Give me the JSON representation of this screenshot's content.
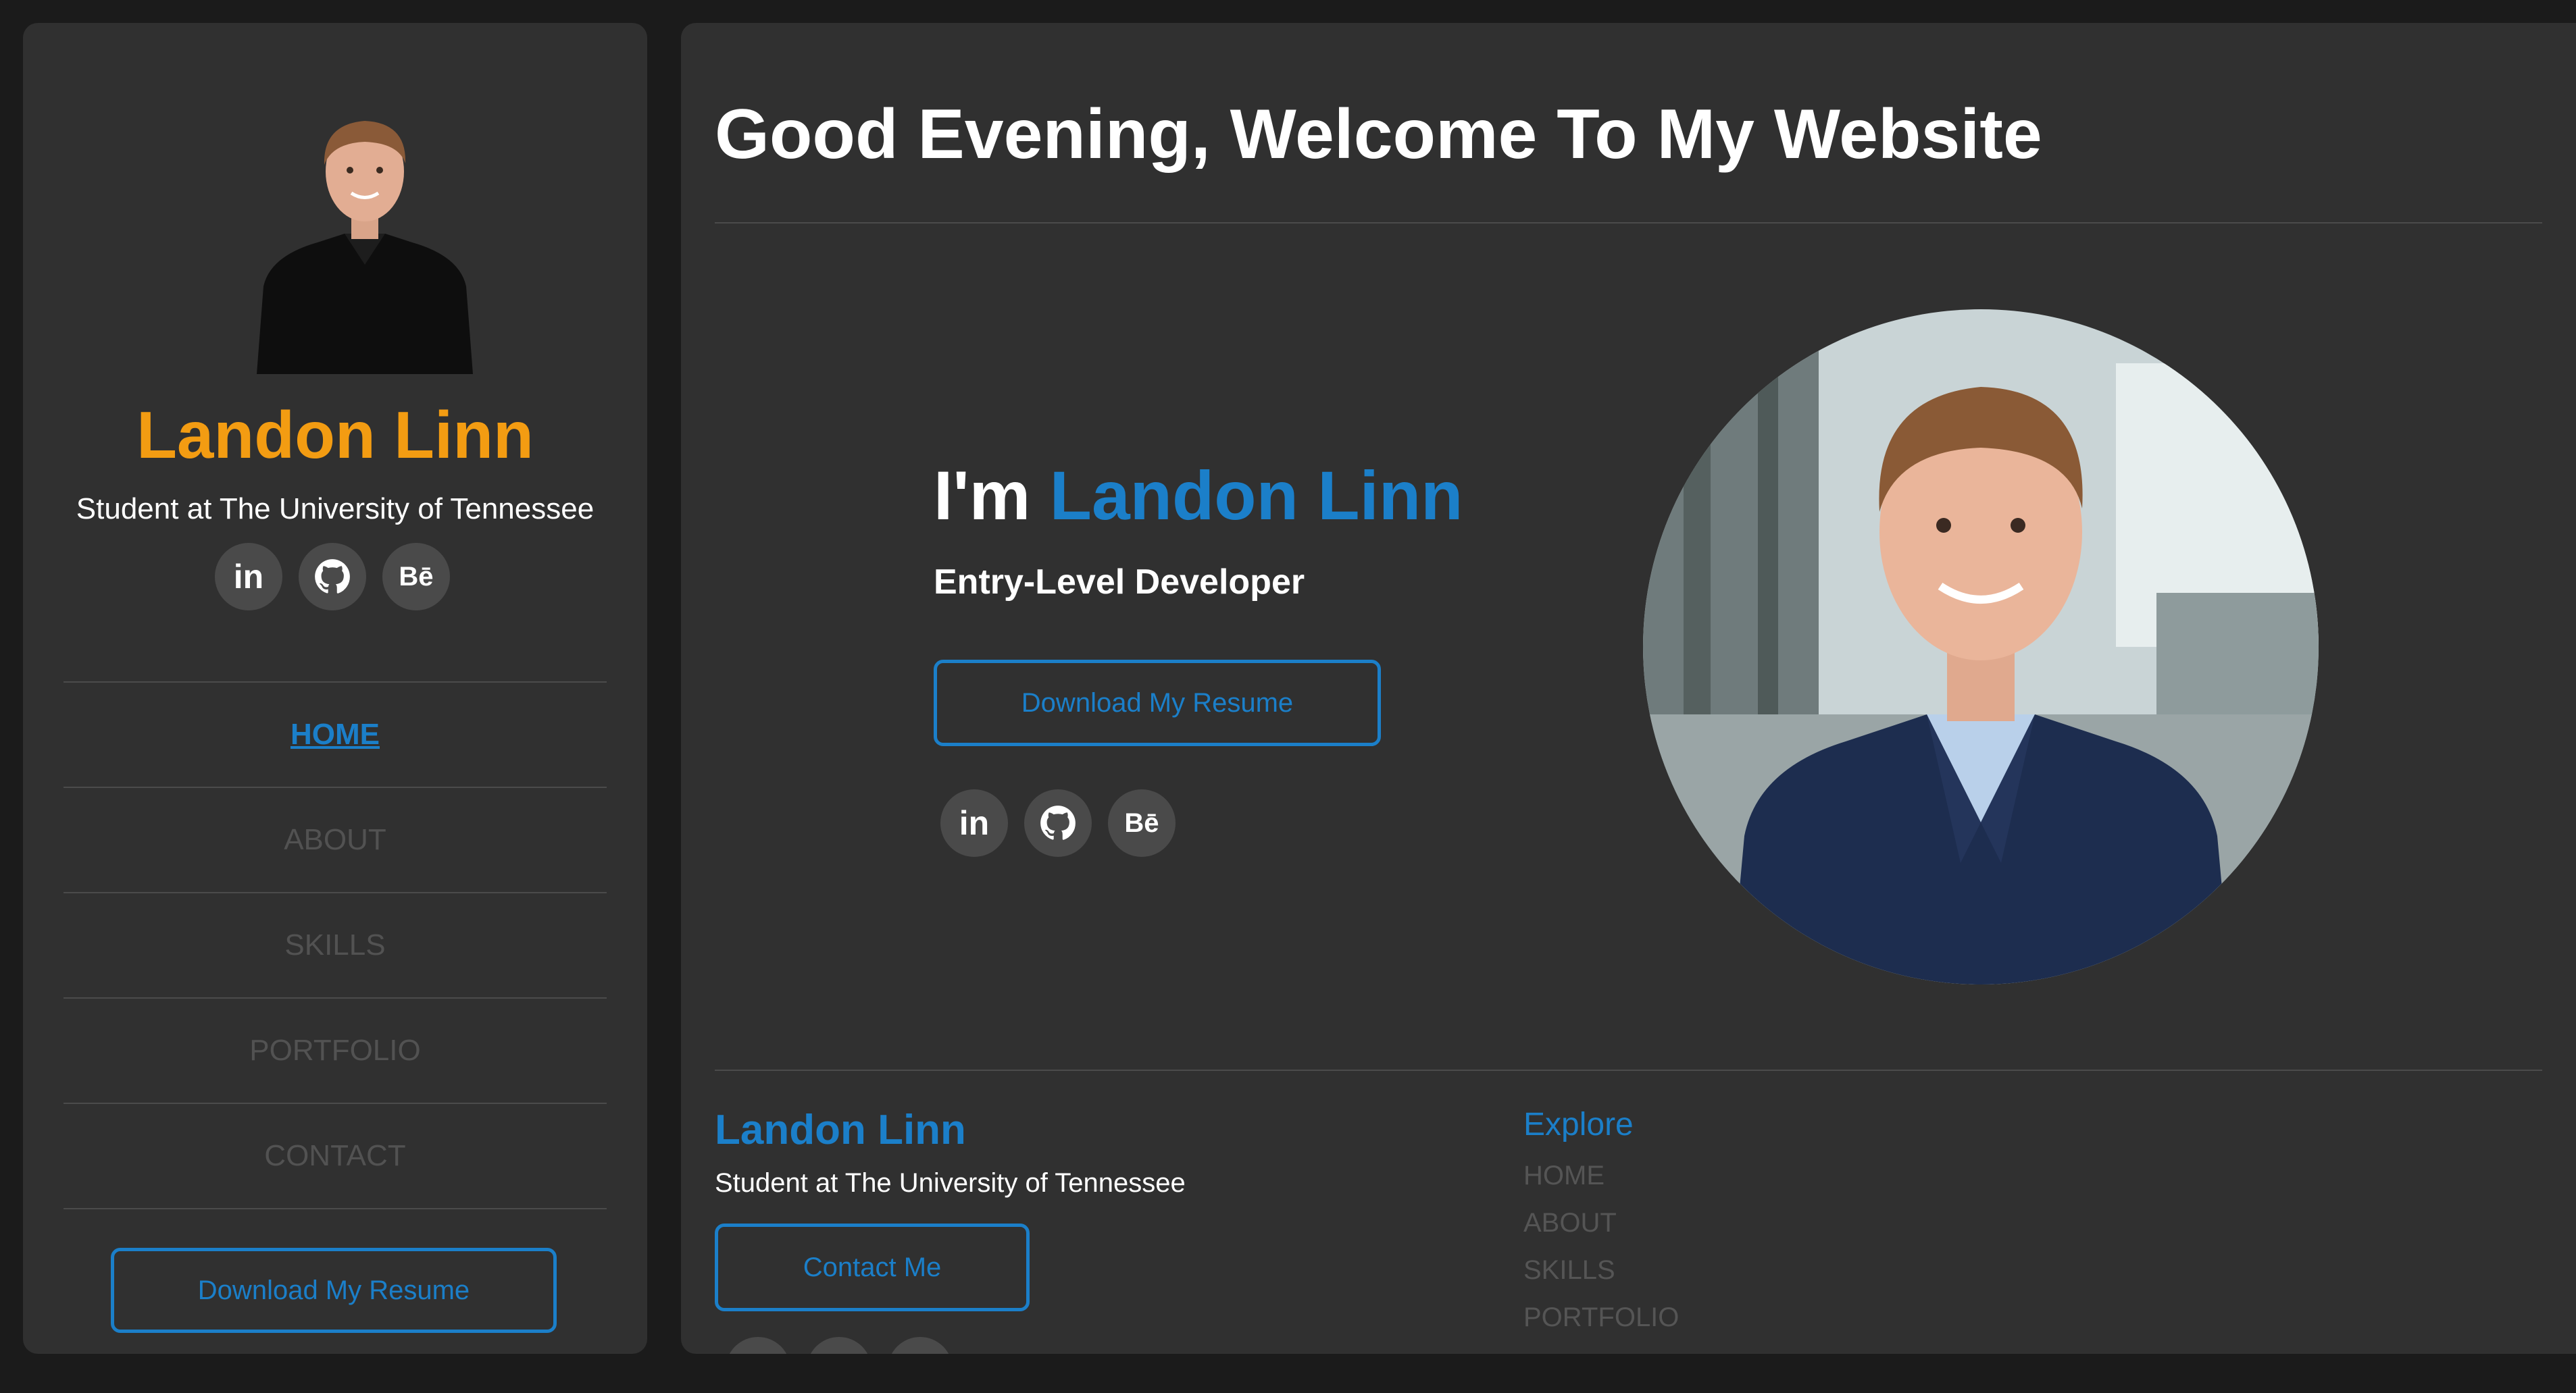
{
  "sidebar": {
    "name": "Landon Linn",
    "subtitle": "Student at The University of Tennessee",
    "socials": [
      {
        "icon": "linkedin-icon",
        "glyph": "in"
      },
      {
        "icon": "github-icon",
        "glyph": ""
      },
      {
        "icon": "behance-icon",
        "glyph": "Bē"
      }
    ],
    "nav": [
      {
        "label": "HOME",
        "active": true
      },
      {
        "label": "ABOUT",
        "active": false
      },
      {
        "label": "SKILLS",
        "active": false
      },
      {
        "label": "PORTFOLIO",
        "active": false
      },
      {
        "label": "CONTACT",
        "active": false
      }
    ],
    "resume_button": "Download My Resume"
  },
  "main": {
    "greeting": "Good Evening, Welcome To My Website",
    "intro_prefix": "I'm ",
    "intro_name": "Landon Linn",
    "role": "Entry-Level Developer",
    "resume_button": "Download My Resume"
  },
  "footer": {
    "name": "Landon Linn",
    "subtitle": "Student at The University of Tennessee",
    "contact_button": "Contact Me",
    "explore_title": "Explore",
    "explore_links": [
      "HOME",
      "ABOUT",
      "SKILLS",
      "PORTFOLIO"
    ]
  },
  "colors": {
    "accent_blue": "#1b7fc9",
    "accent_orange": "#f39c12",
    "panel_bg": "#303030",
    "page_bg": "#1b1b1b"
  }
}
